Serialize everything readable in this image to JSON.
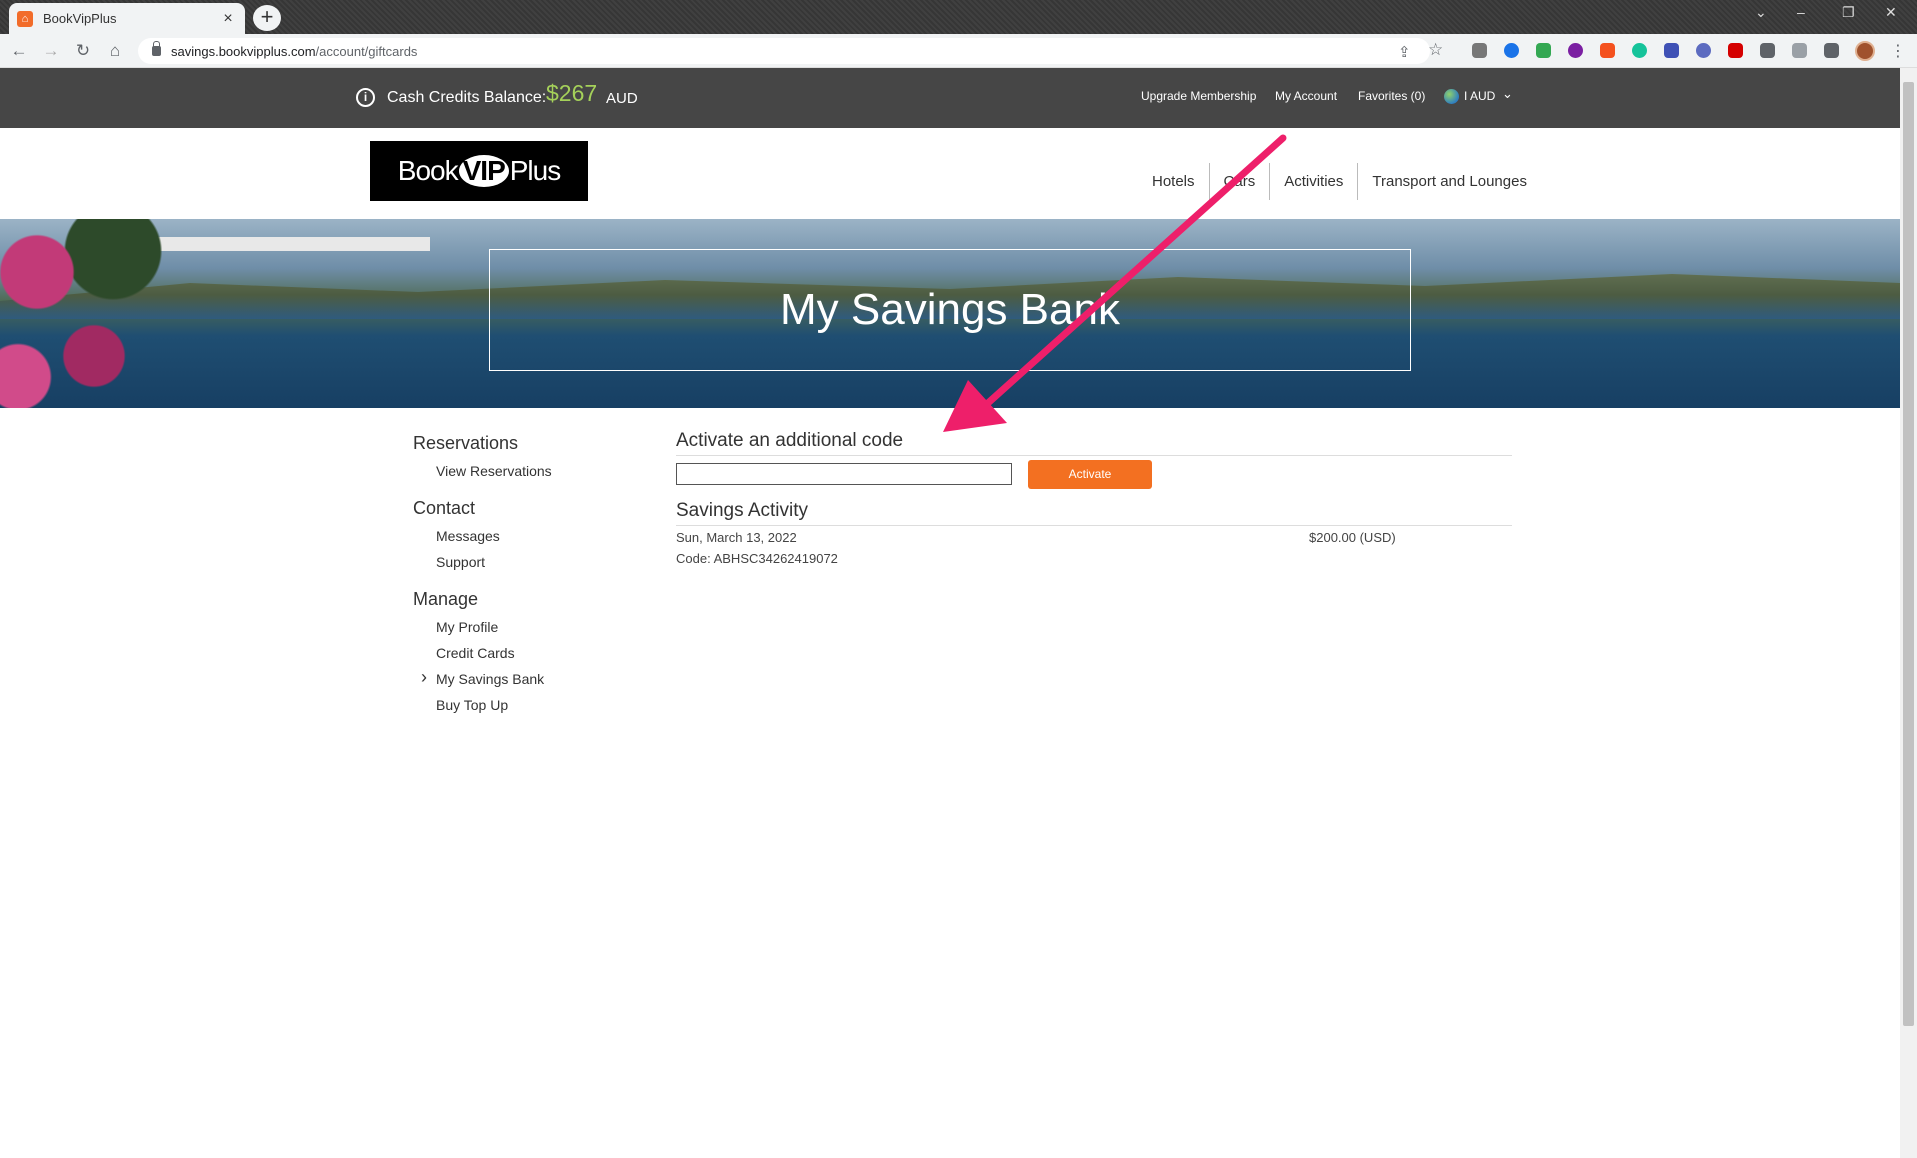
{
  "browser": {
    "tab_title": "BookVipPlus",
    "url_host": "savings.bookvipplus.com",
    "url_path": "/account/giftcards"
  },
  "topbar": {
    "balance_label": "Cash Credits Balance:",
    "balance_amount": "$267",
    "balance_currency": "AUD",
    "links": {
      "upgrade": "Upgrade Membership",
      "account": "My Account",
      "favorites": "Favorites (0)",
      "currency": "I AUD"
    }
  },
  "header": {
    "logo_left": "Book",
    "logo_mid": "VIP",
    "logo_right": "Plus",
    "nav": [
      "Hotels",
      "Cars",
      "Activities",
      "Transport and Lounges"
    ]
  },
  "hero": {
    "title": "My Savings Bank"
  },
  "sidebar": {
    "groups": [
      {
        "heading": "Reservations",
        "items": [
          "View Reservations"
        ]
      },
      {
        "heading": "Contact",
        "items": [
          "Messages",
          "Support"
        ]
      },
      {
        "heading": "Manage",
        "items": [
          "My Profile",
          "Credit Cards",
          "My Savings Bank",
          "Buy Top Up"
        ]
      }
    ]
  },
  "content": {
    "activate_title": "Activate an additional code",
    "code_input_value": "",
    "activate_button": "Activate",
    "activity_title": "Savings Activity",
    "activity": [
      {
        "date": "Sun, March 13, 2022",
        "code": "Code: ABHSC34262419072",
        "amount": "$200.00 (USD)"
      }
    ]
  },
  "colors": {
    "accent_orange": "#f37021",
    "balance_green": "#a5d15a",
    "annotation_arrow": "#ee1f6a"
  }
}
